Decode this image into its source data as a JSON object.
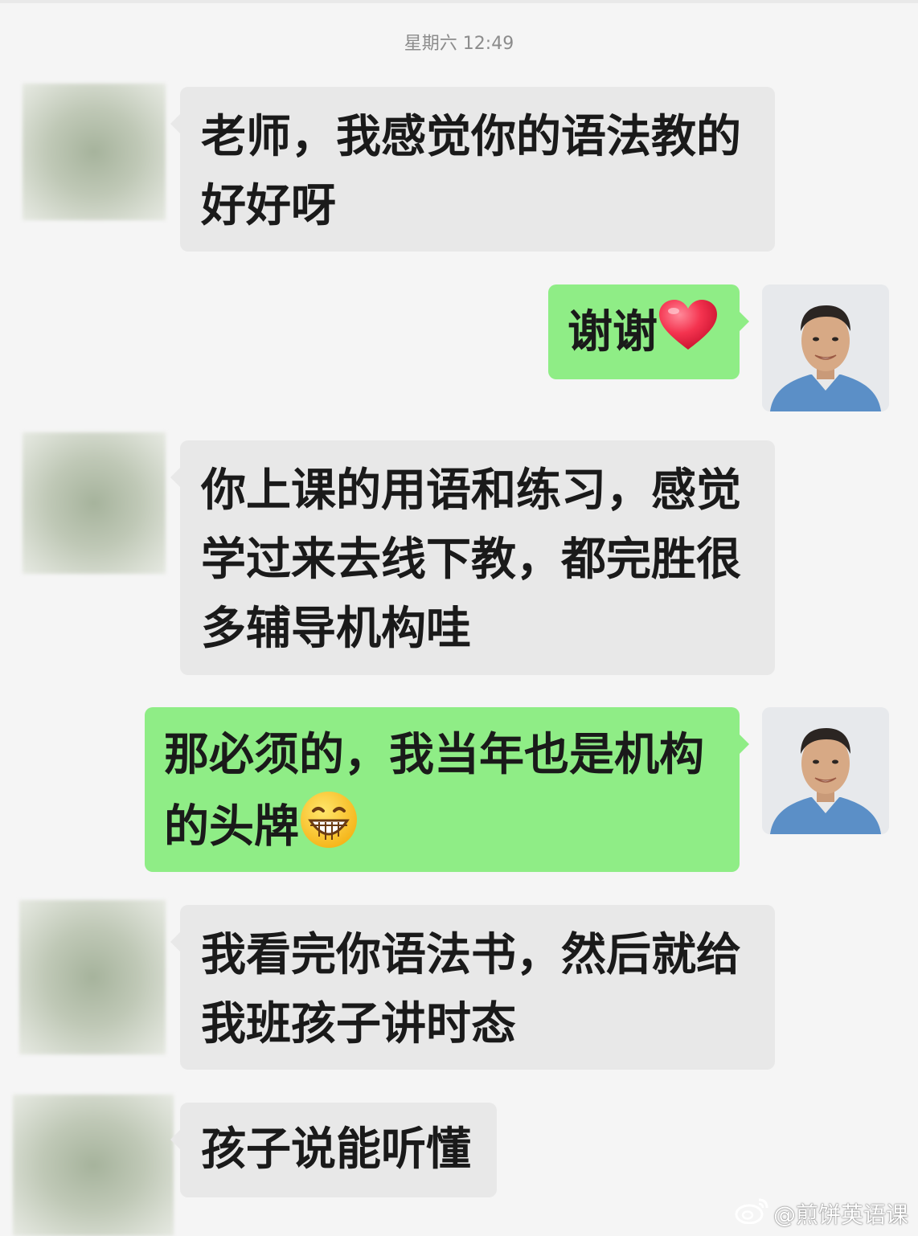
{
  "timestamp": "星期六 12:49",
  "messages": [
    {
      "sender": "other",
      "lines": [
        "老师，我感觉你的语法教的",
        "好好呀"
      ]
    },
    {
      "sender": "me",
      "lines": [
        "谢谢"
      ],
      "emoji": "red-heart-icon"
    },
    {
      "sender": "other",
      "lines": [
        "你上课的用语和练习，感觉",
        "学过来去线下教，都完胜很",
        "多辅导机构哇"
      ]
    },
    {
      "sender": "me",
      "lines": [
        "那必须的，我当年也是机构",
        "的头牌"
      ],
      "emoji": "grinning-face-icon"
    },
    {
      "sender": "other",
      "lines": [
        "我看完你语法书，然后就给",
        "我班孩子讲时态"
      ]
    },
    {
      "sender": "other",
      "lines": [
        "孩子说能听懂"
      ]
    }
  ],
  "watermark": {
    "text": "@煎饼英语课",
    "icon": "weibo-icon"
  },
  "colors": {
    "incoming_bubble": "#e8e8e8",
    "outgoing_bubble": "#8fed86",
    "background": "#f5f5f5"
  }
}
